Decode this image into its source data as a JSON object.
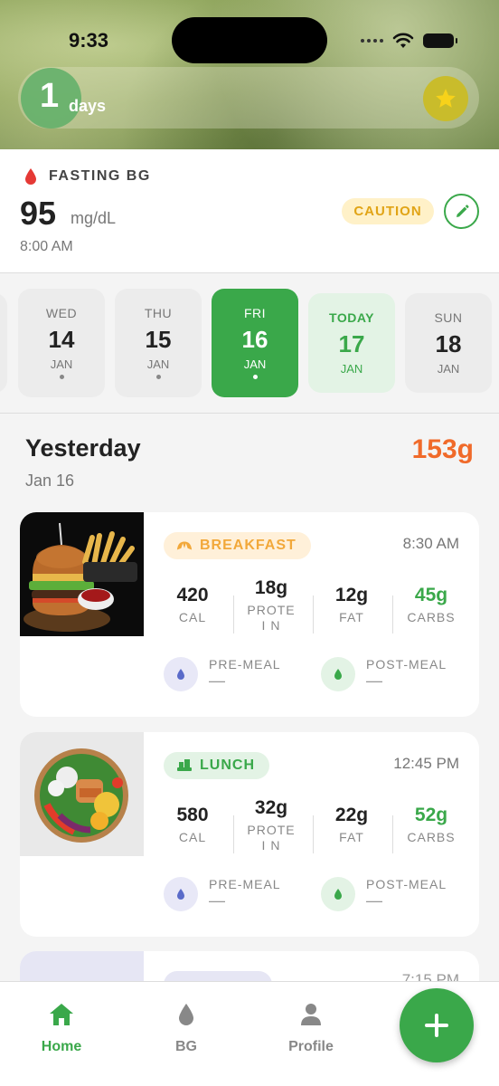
{
  "status_bar": {
    "time": "9:33"
  },
  "streak": {
    "count": "1",
    "label": "days",
    "star_icon": "star-icon"
  },
  "fasting": {
    "title": "FASTING BG",
    "value": "95",
    "unit": "mg/dL",
    "time": "8:00 AM",
    "status": "CAUTION",
    "status_color": "#e1a416"
  },
  "dates": [
    {
      "dow": "WED",
      "num": "14",
      "mon": "JAN",
      "dot": true,
      "state": "default"
    },
    {
      "dow": "THU",
      "num": "15",
      "mon": "JAN",
      "dot": true,
      "state": "default"
    },
    {
      "dow": "FRI",
      "num": "16",
      "mon": "JAN",
      "dot": true,
      "state": "selected"
    },
    {
      "dow": "TODAY",
      "num": "17",
      "mon": "JAN",
      "dot": false,
      "state": "today"
    },
    {
      "dow": "SUN",
      "num": "18",
      "mon": "JAN",
      "dot": false,
      "state": "plain"
    }
  ],
  "section": {
    "title": "Yesterday",
    "date": "Jan 16",
    "total": "153g",
    "total_color": "#f06a2a"
  },
  "meals": [
    {
      "type": "BREAKFAST",
      "time": "8:30 AM",
      "cal": "420",
      "cal_label": "CAL",
      "protein": "18g",
      "protein_label": "PROTEI N",
      "fat": "12g",
      "fat_label": "FAT",
      "carbs": "45g",
      "carbs_label": "CARBS",
      "pre_label": "PRE-MEAL",
      "pre_value": "—",
      "post_label": "POST-MEAL",
      "post_value": "—"
    },
    {
      "type": "LUNCH",
      "time": "12:45 PM",
      "cal": "580",
      "cal_label": "CAL",
      "protein": "32g",
      "protein_label": "PROTEI N",
      "fat": "22g",
      "fat_label": "FAT",
      "carbs": "52g",
      "carbs_label": "CARBS",
      "pre_label": "PRE-MEAL",
      "pre_value": "—",
      "post_label": "POST-MEAL",
      "post_value": "—"
    }
  ],
  "peek_meal": {
    "time": "7:15 PM"
  },
  "tabs": [
    {
      "label": "Home",
      "icon": "home-icon",
      "active": true
    },
    {
      "label": "BG",
      "icon": "drop-icon",
      "active": false
    },
    {
      "label": "Profile",
      "icon": "person-icon",
      "active": false
    }
  ],
  "fab": {
    "icon": "plus-icon"
  },
  "colors": {
    "accent": "#3aa84a",
    "warning": "#e1a416",
    "orange": "#f06a2a"
  }
}
